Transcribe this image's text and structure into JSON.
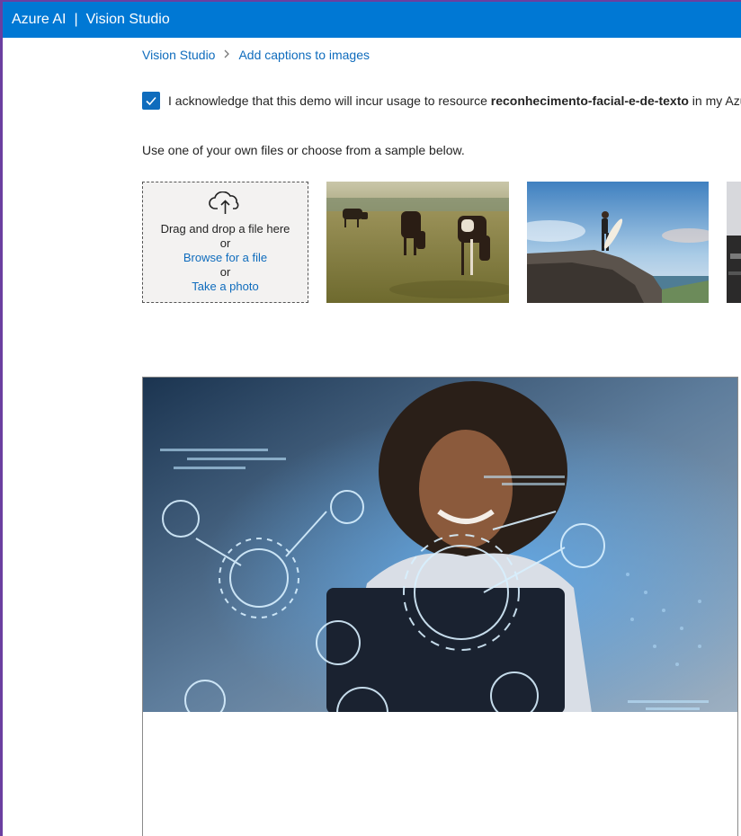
{
  "header": {
    "brand": "Azure AI",
    "separator": "|",
    "product": "Vision Studio"
  },
  "breadcrumb": {
    "root": "Vision Studio",
    "current": "Add captions to images"
  },
  "acknowledge": {
    "checked": true,
    "prefix": "I acknowledge that this demo will incur usage to resource ",
    "resource": "reconhecimento-facial-e-de-texto",
    "suffix": " in my Azu"
  },
  "intro_text": "Use one of your own files or choose from a sample below.",
  "upload": {
    "drag_text": "Drag and drop a file here",
    "or1": "or",
    "browse": "Browse for a file",
    "or2": "or",
    "photo": "Take a photo"
  },
  "samples": [
    {
      "name": "cows-grazing"
    },
    {
      "name": "surfer-on-rock"
    },
    {
      "name": "city-partial"
    }
  ],
  "colors": {
    "accent": "#0078d4",
    "link": "#0f6cbd"
  }
}
